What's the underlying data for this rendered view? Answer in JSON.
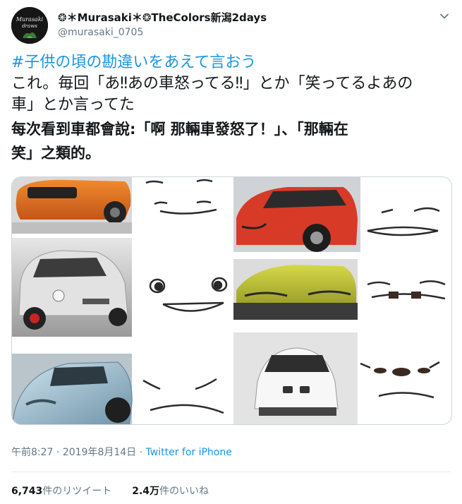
{
  "header": {
    "display_name": "❂＊Murasaki＊❂TheColors新潟2days",
    "handle": "@murasaki_0705",
    "avatar_text": "Murasaki draws"
  },
  "tweet": {
    "hashtag": "#子供の頃の勘違いをあえて言おう",
    "line1": "これ。毎回「あ‼あの車怒ってる‼」とか「笑ってるよあの",
    "line2": "車」とか言ってた",
    "translation_line1": "每次看到車都會說:「啊 那輛車發怒了！」、「那輛在",
    "translation_line2": "笑」之類的。"
  },
  "meta": {
    "time": "午前8:27",
    "separator": " · ",
    "date": "2019年8月14日",
    "source": "Twitter for iPhone"
  },
  "stats": {
    "retweets_count": "6,743",
    "retweets_label": "件のリツイート",
    "likes_count": "2.4万",
    "likes_label": "件のいいね"
  },
  "colors": {
    "link": "#1b95e0",
    "muted": "#657786",
    "text": "#14171a",
    "border": "#ccd6dd"
  },
  "icons": {
    "caret": "chevron-down-icon"
  }
}
